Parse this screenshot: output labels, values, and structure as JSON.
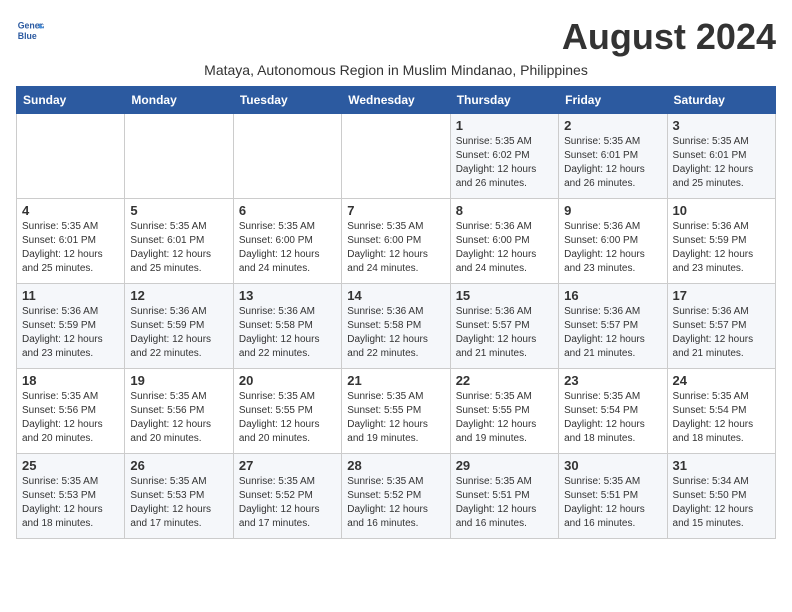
{
  "logo": {
    "text_line1": "General",
    "text_line2": "Blue"
  },
  "title": "August 2024",
  "subtitle": "Mataya, Autonomous Region in Muslim Mindanao, Philippines",
  "headers": [
    "Sunday",
    "Monday",
    "Tuesday",
    "Wednesday",
    "Thursday",
    "Friday",
    "Saturday"
  ],
  "weeks": [
    [
      {
        "day": "",
        "info": ""
      },
      {
        "day": "",
        "info": ""
      },
      {
        "day": "",
        "info": ""
      },
      {
        "day": "",
        "info": ""
      },
      {
        "day": "1",
        "info": "Sunrise: 5:35 AM\nSunset: 6:02 PM\nDaylight: 12 hours\nand 26 minutes."
      },
      {
        "day": "2",
        "info": "Sunrise: 5:35 AM\nSunset: 6:01 PM\nDaylight: 12 hours\nand 26 minutes."
      },
      {
        "day": "3",
        "info": "Sunrise: 5:35 AM\nSunset: 6:01 PM\nDaylight: 12 hours\nand 25 minutes."
      }
    ],
    [
      {
        "day": "4",
        "info": "Sunrise: 5:35 AM\nSunset: 6:01 PM\nDaylight: 12 hours\nand 25 minutes."
      },
      {
        "day": "5",
        "info": "Sunrise: 5:35 AM\nSunset: 6:01 PM\nDaylight: 12 hours\nand 25 minutes."
      },
      {
        "day": "6",
        "info": "Sunrise: 5:35 AM\nSunset: 6:00 PM\nDaylight: 12 hours\nand 24 minutes."
      },
      {
        "day": "7",
        "info": "Sunrise: 5:35 AM\nSunset: 6:00 PM\nDaylight: 12 hours\nand 24 minutes."
      },
      {
        "day": "8",
        "info": "Sunrise: 5:36 AM\nSunset: 6:00 PM\nDaylight: 12 hours\nand 24 minutes."
      },
      {
        "day": "9",
        "info": "Sunrise: 5:36 AM\nSunset: 6:00 PM\nDaylight: 12 hours\nand 23 minutes."
      },
      {
        "day": "10",
        "info": "Sunrise: 5:36 AM\nSunset: 5:59 PM\nDaylight: 12 hours\nand 23 minutes."
      }
    ],
    [
      {
        "day": "11",
        "info": "Sunrise: 5:36 AM\nSunset: 5:59 PM\nDaylight: 12 hours\nand 23 minutes."
      },
      {
        "day": "12",
        "info": "Sunrise: 5:36 AM\nSunset: 5:59 PM\nDaylight: 12 hours\nand 22 minutes."
      },
      {
        "day": "13",
        "info": "Sunrise: 5:36 AM\nSunset: 5:58 PM\nDaylight: 12 hours\nand 22 minutes."
      },
      {
        "day": "14",
        "info": "Sunrise: 5:36 AM\nSunset: 5:58 PM\nDaylight: 12 hours\nand 22 minutes."
      },
      {
        "day": "15",
        "info": "Sunrise: 5:36 AM\nSunset: 5:57 PM\nDaylight: 12 hours\nand 21 minutes."
      },
      {
        "day": "16",
        "info": "Sunrise: 5:36 AM\nSunset: 5:57 PM\nDaylight: 12 hours\nand 21 minutes."
      },
      {
        "day": "17",
        "info": "Sunrise: 5:36 AM\nSunset: 5:57 PM\nDaylight: 12 hours\nand 21 minutes."
      }
    ],
    [
      {
        "day": "18",
        "info": "Sunrise: 5:35 AM\nSunset: 5:56 PM\nDaylight: 12 hours\nand 20 minutes."
      },
      {
        "day": "19",
        "info": "Sunrise: 5:35 AM\nSunset: 5:56 PM\nDaylight: 12 hours\nand 20 minutes."
      },
      {
        "day": "20",
        "info": "Sunrise: 5:35 AM\nSunset: 5:55 PM\nDaylight: 12 hours\nand 20 minutes."
      },
      {
        "day": "21",
        "info": "Sunrise: 5:35 AM\nSunset: 5:55 PM\nDaylight: 12 hours\nand 19 minutes."
      },
      {
        "day": "22",
        "info": "Sunrise: 5:35 AM\nSunset: 5:55 PM\nDaylight: 12 hours\nand 19 minutes."
      },
      {
        "day": "23",
        "info": "Sunrise: 5:35 AM\nSunset: 5:54 PM\nDaylight: 12 hours\nand 18 minutes."
      },
      {
        "day": "24",
        "info": "Sunrise: 5:35 AM\nSunset: 5:54 PM\nDaylight: 12 hours\nand 18 minutes."
      }
    ],
    [
      {
        "day": "25",
        "info": "Sunrise: 5:35 AM\nSunset: 5:53 PM\nDaylight: 12 hours\nand 18 minutes."
      },
      {
        "day": "26",
        "info": "Sunrise: 5:35 AM\nSunset: 5:53 PM\nDaylight: 12 hours\nand 17 minutes."
      },
      {
        "day": "27",
        "info": "Sunrise: 5:35 AM\nSunset: 5:52 PM\nDaylight: 12 hours\nand 17 minutes."
      },
      {
        "day": "28",
        "info": "Sunrise: 5:35 AM\nSunset: 5:52 PM\nDaylight: 12 hours\nand 16 minutes."
      },
      {
        "day": "29",
        "info": "Sunrise: 5:35 AM\nSunset: 5:51 PM\nDaylight: 12 hours\nand 16 minutes."
      },
      {
        "day": "30",
        "info": "Sunrise: 5:35 AM\nSunset: 5:51 PM\nDaylight: 12 hours\nand 16 minutes."
      },
      {
        "day": "31",
        "info": "Sunrise: 5:34 AM\nSunset: 5:50 PM\nDaylight: 12 hours\nand 15 minutes."
      }
    ]
  ]
}
